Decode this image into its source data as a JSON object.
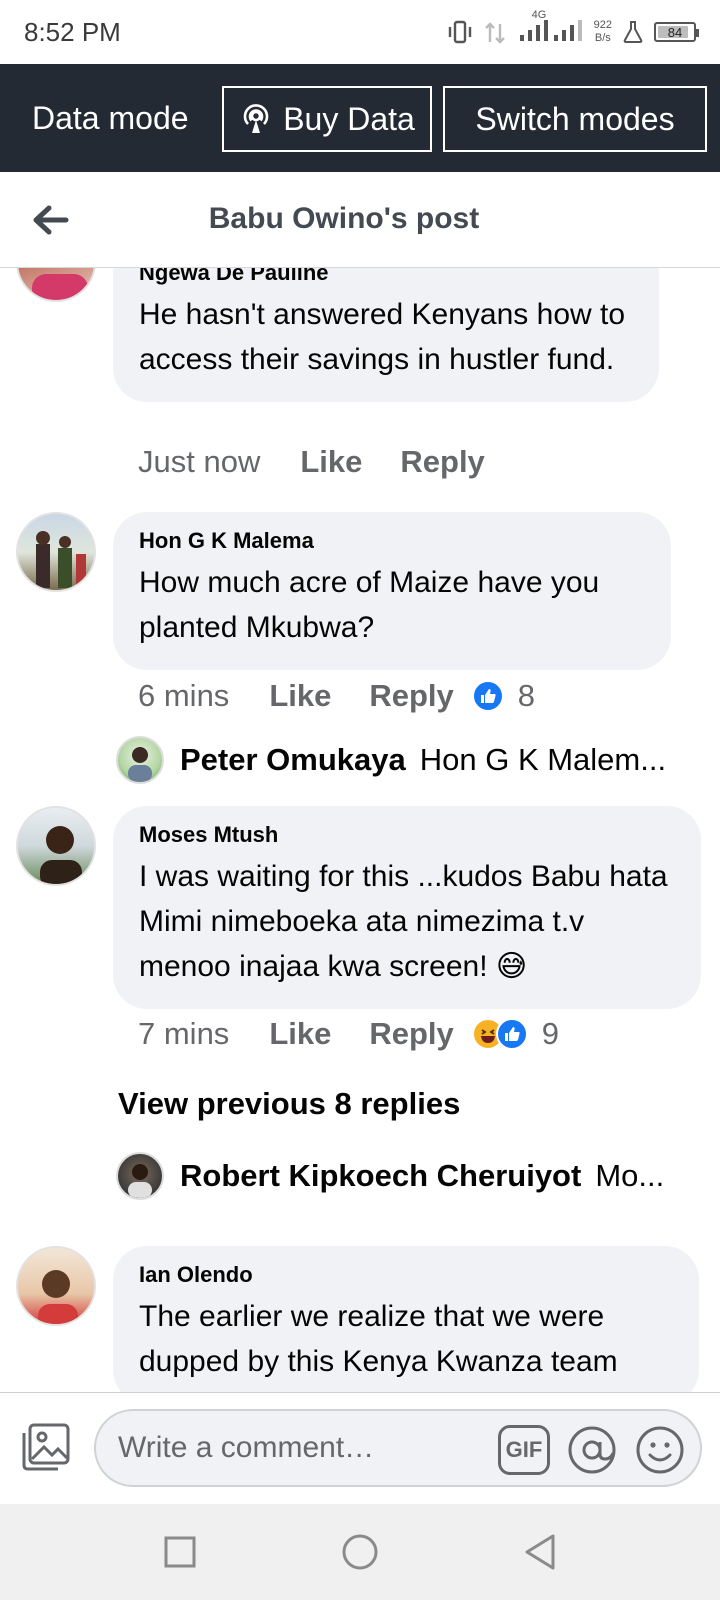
{
  "status_bar": {
    "time": "8:52 PM",
    "network_type": "4G",
    "net_speed_value": "922",
    "net_speed_unit": "B/s",
    "battery": "84",
    "icons": [
      "vibrate-icon",
      "signal-icon",
      "signal-icon",
      "lab-icon",
      "battery-icon"
    ]
  },
  "data_bar": {
    "mode_label": "Data mode",
    "buy_label": "Buy Data",
    "switch_label": "Switch modes"
  },
  "header": {
    "title": "Babu Owino's post",
    "back_icon": "back-arrow-icon"
  },
  "comments": [
    {
      "author": "Ngewa De Pauline",
      "text": "He hasn't answered Kenyans how to access their savings in hustler fund.",
      "time": "Just now",
      "like": "Like",
      "reply": "Reply"
    },
    {
      "author": "Hon G K Malema",
      "text": "How much acre of Maize have you planted Mkubwa?",
      "time": "6 mins",
      "like": "Like",
      "reply": "Reply",
      "reactions": [
        "like"
      ],
      "reaction_count": "8",
      "reply_preview": {
        "name": "Peter Omukaya",
        "snippet": "Hon G K Malem..."
      }
    },
    {
      "author": "Moses Mtush",
      "text": "I was waiting for this ...kudos Babu hata Mimi nimeboeka ata nimezima t.v menoo inajaa kwa screen! 😅",
      "time": "7 mins",
      "like": "Like",
      "reply": "Reply",
      "reactions": [
        "haha",
        "like"
      ],
      "reaction_count": "9",
      "view_previous": "View previous 8 replies",
      "reply_preview": {
        "name": "Robert Kipkoech Cheruiyot",
        "snippet": "Mo..."
      }
    },
    {
      "author": "Ian Olendo",
      "text": "The earlier we realize that we were dupped by this Kenya Kwanza team"
    }
  ],
  "composer": {
    "placeholder": "Write a comment…",
    "gif_label": "GIF",
    "icons": [
      "photo-icon",
      "mention-icon",
      "emoji-icon"
    ]
  },
  "nav_bar": {
    "icons": [
      "recents-square-icon",
      "home-circle-icon",
      "back-triangle-icon"
    ]
  },
  "colors": {
    "data_bar_bg": "#242a33",
    "bubble_bg": "#f0f2f5",
    "like_blue": "#1877f2",
    "meta_gray": "#65676b"
  }
}
